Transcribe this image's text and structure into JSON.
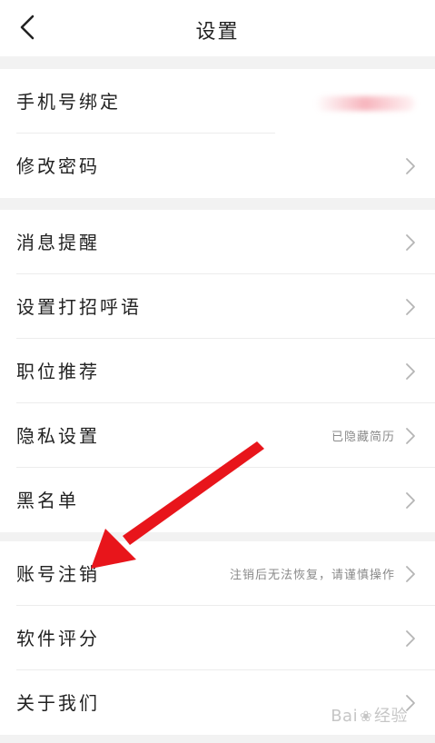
{
  "header": {
    "title": "设置",
    "back_icon": "chevron-left-icon"
  },
  "groups": [
    {
      "items": [
        {
          "label": "手机号绑定",
          "value": "",
          "value_obscured": true
        },
        {
          "label": "修改密码",
          "value": ""
        }
      ]
    },
    {
      "items": [
        {
          "label": "消息提醒",
          "value": ""
        },
        {
          "label": "设置打招呼语",
          "value": ""
        },
        {
          "label": "职位推荐",
          "value": ""
        },
        {
          "label": "隐私设置",
          "value": "已隐藏简历"
        },
        {
          "label": "黑名单",
          "value": ""
        }
      ]
    },
    {
      "items": [
        {
          "label": "账号注销",
          "value": "注销后无法恢复，请谨慎操作"
        },
        {
          "label": "软件评分",
          "value": ""
        },
        {
          "label": "关于我们",
          "value": ""
        }
      ]
    }
  ],
  "annotation": {
    "arrow_color": "#e8151b",
    "points_to": "账号注销"
  },
  "watermark": {
    "text_left": "Bai",
    "text_right": "经验"
  },
  "colors": {
    "background": "#f2f2f2",
    "card": "#ffffff",
    "chevron": "#b5b5b5",
    "secondary_text": "#8a8a8a"
  }
}
